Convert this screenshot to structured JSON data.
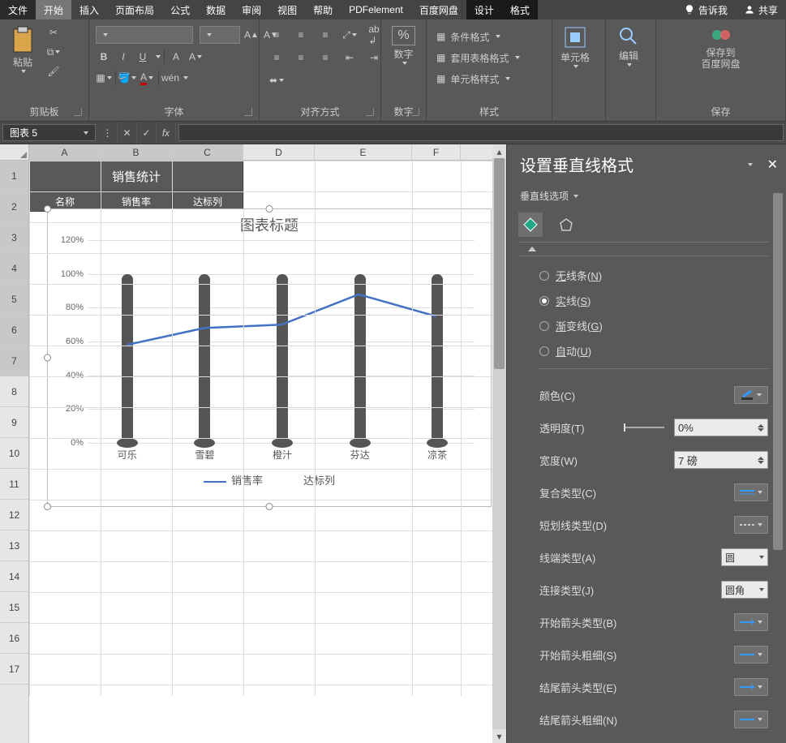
{
  "tabs": {
    "file": "文件",
    "home": "开始",
    "insert": "插入",
    "layout": "页面布局",
    "formula": "公式",
    "data": "数据",
    "review": "审阅",
    "view": "视图",
    "help": "帮助",
    "pdfe": "PDFelement",
    "baidu": "百度网盘",
    "design": "设计",
    "format": "格式",
    "tellme": "告诉我",
    "share": "共享"
  },
  "ribbon": {
    "paste": "粘贴",
    "clipboard": "剪贴板",
    "font": "字体",
    "align": "对齐方式",
    "number": "数字",
    "numberBtn": "数字",
    "styles": "样式",
    "cond": "条件格式",
    "tableFmt": "套用表格格式",
    "cellStyle": "单元格样式",
    "cells": "单元格",
    "edit": "编辑",
    "saveBaidu": "保存到\n百度网盘",
    "save": "保存",
    "bold": "B",
    "italic": "I",
    "underline": "U",
    "wen": "wén"
  },
  "namebox": "图表 5",
  "fx": "fx",
  "sheet": {
    "cols": [
      "A",
      "B",
      "C",
      "D",
      "E",
      "F"
    ],
    "title": "销售统计",
    "heads": [
      "名称",
      "销售率",
      "达标列"
    ]
  },
  "chart_data": {
    "type": "bar+line",
    "title": "图表标题",
    "categories": [
      "可乐",
      "雪碧",
      "橙汁",
      "芬达",
      "凉茶"
    ],
    "series": [
      {
        "name": "达标列",
        "type": "bar",
        "values": [
          100,
          100,
          100,
          100,
          100
        ]
      },
      {
        "name": "销售率",
        "type": "line",
        "values": [
          58,
          68,
          70,
          88,
          75
        ]
      }
    ],
    "ytick_labels": [
      "0%",
      "20%",
      "40%",
      "60%",
      "80%",
      "100%",
      "120%"
    ],
    "ylim": [
      0,
      120
    ],
    "legend": [
      "销售率",
      "达标列"
    ]
  },
  "panel": {
    "title": "设置垂直线格式",
    "subtitle": "垂直线选项",
    "radios": {
      "none": "无线条(N)",
      "solid": "实线(S)",
      "grad": "渐变线(G)",
      "auto": "自动(U)"
    },
    "props": {
      "color": "颜色(C)",
      "trans": "透明度(T)",
      "transVal": "0%",
      "width": "宽度(W)",
      "widthVal": "7 磅",
      "compound": "复合类型(C)",
      "dash": "短划线类型(D)",
      "cap": "线端类型(A)",
      "capVal": "圆",
      "join": "连接类型(J)",
      "joinVal": "圆角",
      "beginArrow": "开始箭头类型(B)",
      "beginSize": "开始箭头粗细(S)",
      "endArrow": "结尾箭头类型(E)",
      "endSize": "结尾箭头粗细(N)"
    }
  }
}
